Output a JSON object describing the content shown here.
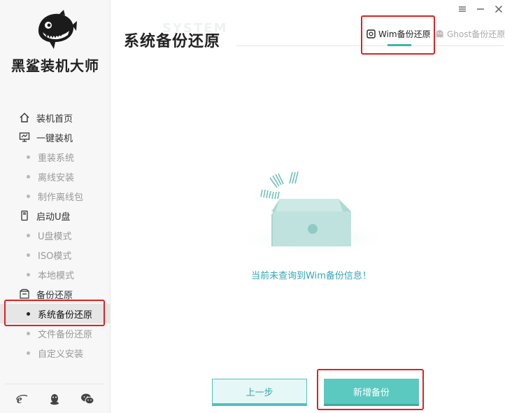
{
  "app": {
    "brand": "黑鲨装机大师"
  },
  "sidebar": {
    "items": [
      {
        "label": "装机首页",
        "icon": "home-icon",
        "level": "main"
      },
      {
        "label": "一键装机",
        "icon": "monitor-icon",
        "level": "main"
      },
      {
        "label": "重装系统",
        "level": "sub"
      },
      {
        "label": "离线安装",
        "level": "sub"
      },
      {
        "label": "制作离线包",
        "level": "sub"
      },
      {
        "label": "启动U盘",
        "icon": "usb-drive-icon",
        "level": "main"
      },
      {
        "label": "U盘模式",
        "level": "sub"
      },
      {
        "label": "ISO模式",
        "level": "sub"
      },
      {
        "label": "本地模式",
        "level": "sub"
      },
      {
        "label": "备份还原",
        "icon": "backup-icon",
        "level": "main"
      },
      {
        "label": "系统备份还原",
        "level": "sub",
        "active": true
      },
      {
        "label": "文件备份还原",
        "level": "sub"
      },
      {
        "label": "自定义安装",
        "level": "sub"
      }
    ],
    "footer_icons": [
      "ie-browser-icon",
      "qq-penguin-icon",
      "wechat-icon"
    ]
  },
  "header": {
    "title": "系统备份还原",
    "watermark": "SYSTEM",
    "tabs": [
      {
        "label": "Wim备份还原",
        "icon": "wim-disk-icon",
        "active": true
      },
      {
        "label": "Ghost备份还原",
        "icon": "ghost-icon",
        "active": false
      }
    ]
  },
  "main": {
    "empty_message": "当前未查询到Wim备份信息！",
    "illustration": "empty-box-icon"
  },
  "buttons": {
    "prev_label": "上一步",
    "new_backup_label": "新增备份"
  },
  "colors": {
    "accent": "#5bc9bf",
    "accent_dark": "#3fa9a1",
    "message_text": "#37a6b8",
    "highlight_box": "#e02020"
  }
}
